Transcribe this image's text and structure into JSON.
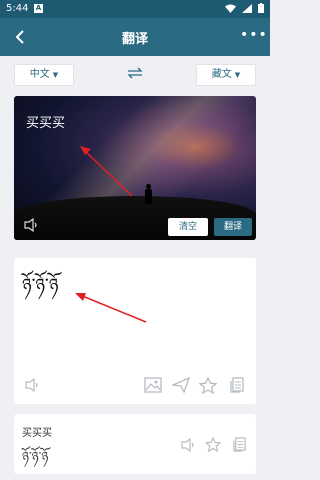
{
  "status_bar": {
    "time": "5:44",
    "app_icon": "A"
  },
  "app_bar": {
    "back_icon": "chevron-left-icon",
    "title": "翻译",
    "more_icon": "more-icon"
  },
  "languages": {
    "source": "中文",
    "target": "藏文",
    "swap_icon": "swap-arrows-icon"
  },
  "input": {
    "text": "买买买",
    "clear_label": "清空",
    "translate_label": "翻译"
  },
  "result": {
    "text": "ཉོ་ཉོ་ཉོ"
  },
  "history": {
    "source": "买买买",
    "translation": "ཉོ་ཉོ་ཉོ"
  },
  "colors": {
    "accent": "#2b6a83",
    "annotation_arrow": "#e02020"
  }
}
